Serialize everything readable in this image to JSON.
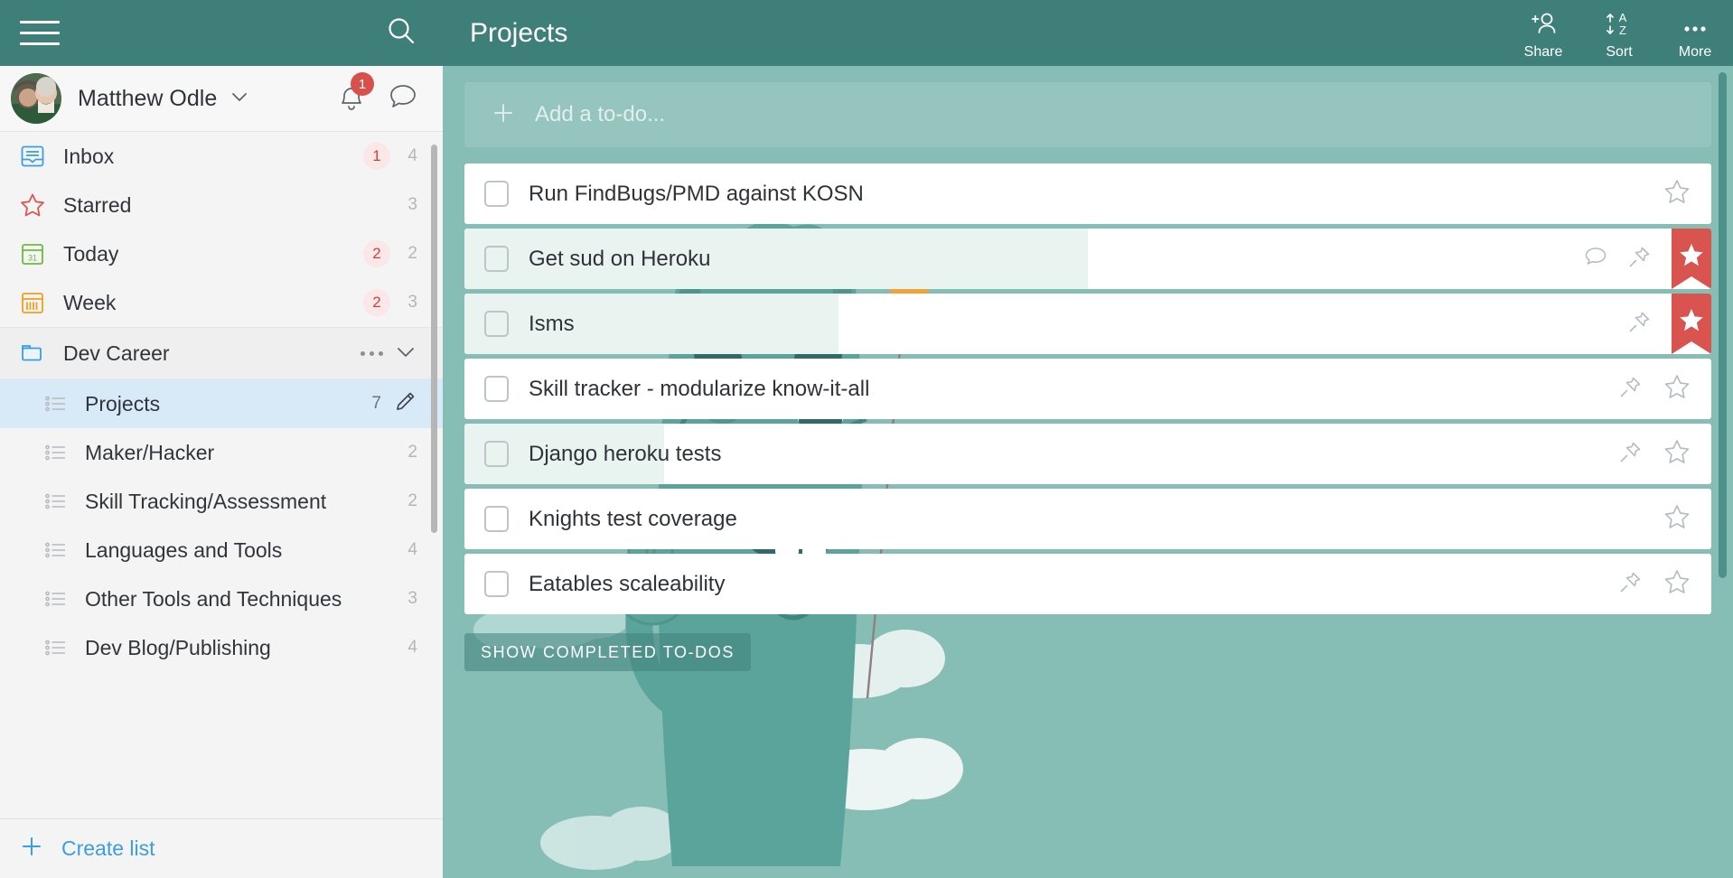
{
  "sidebar": {
    "topbar": {
      "menu_icon": "hamburger-icon",
      "search_icon": "search-icon"
    },
    "user": {
      "name": "Matthew Odle",
      "chevron_icon": "chevron-down-icon",
      "bell_icon": "bell-icon",
      "bell_badge": "1",
      "chat_icon": "chat-bubble-icon",
      "avatar_icon": "user-avatar"
    },
    "smart_lists": [
      {
        "label": "Inbox",
        "icon": "inbox-icon",
        "badge": "1",
        "count": "4"
      },
      {
        "label": "Starred",
        "icon": "star-icon",
        "badge": "",
        "count": "3"
      },
      {
        "label": "Today",
        "icon": "calendar-icon",
        "badge": "2",
        "count": "2"
      },
      {
        "label": "Week",
        "icon": "week-icon",
        "badge": "2",
        "count": "3"
      }
    ],
    "folder": {
      "label": "Dev Career",
      "icon": "folder-icon",
      "more_icon": "more-dots-icon",
      "collapse_icon": "chevron-down-icon"
    },
    "lists": [
      {
        "label": "Projects",
        "count": "7",
        "active": true,
        "edit_icon": "pencil-icon"
      },
      {
        "label": "Maker/Hacker",
        "count": "2",
        "active": false,
        "edit_icon": ""
      },
      {
        "label": "Skill Tracking/Assessment",
        "count": "2",
        "active": false,
        "edit_icon": ""
      },
      {
        "label": "Languages and Tools",
        "count": "4",
        "active": false,
        "edit_icon": ""
      },
      {
        "label": "Other Tools and Techniques",
        "count": "3",
        "active": false,
        "edit_icon": ""
      },
      {
        "label": "Dev Blog/Publishing",
        "count": "4",
        "active": false,
        "edit_icon": ""
      }
    ],
    "create_list": {
      "label": "Create list",
      "icon": "plus-icon"
    }
  },
  "header": {
    "title": "Projects",
    "actions": [
      {
        "label": "Share",
        "icon": "share-person-icon"
      },
      {
        "label": "Sort",
        "icon": "sort-az-icon"
      },
      {
        "label": "More",
        "icon": "more-dots-icon"
      }
    ]
  },
  "main": {
    "add_todo": {
      "placeholder": "Add a to-do...",
      "icon": "plus-icon"
    },
    "todos": [
      {
        "title": "Run FindBugs/PMD against KOSN",
        "fill_pct": 0,
        "starred": false,
        "has_comment": false,
        "has_pin": false
      },
      {
        "title": "Get sud on Heroku",
        "fill_pct": 50,
        "starred": true,
        "has_comment": true,
        "has_pin": true
      },
      {
        "title": "Isms",
        "fill_pct": 30,
        "starred": true,
        "has_comment": false,
        "has_pin": true
      },
      {
        "title": "Skill tracker - modularize know-it-all",
        "fill_pct": 0,
        "starred": false,
        "has_comment": false,
        "has_pin": true
      },
      {
        "title": "Django heroku tests",
        "fill_pct": 16,
        "starred": false,
        "has_comment": false,
        "has_pin": true
      },
      {
        "title": "Knights test coverage",
        "fill_pct": 0,
        "starred": false,
        "has_comment": false,
        "has_pin": false
      },
      {
        "title": "Eatables scaleability",
        "fill_pct": 0,
        "starred": false,
        "has_comment": false,
        "has_pin": true
      }
    ],
    "show_completed_label": "SHOW COMPLETED TO-DOS"
  },
  "colors": {
    "header_teal": "#3e7f79",
    "content_teal": "#86bdb5",
    "accent_blue": "#3b9ee0",
    "badge_red": "#d8504a",
    "star_red": "#d9534f",
    "selected_row": "#d8eaf8",
    "todo_fill": "#e9f4f1"
  }
}
